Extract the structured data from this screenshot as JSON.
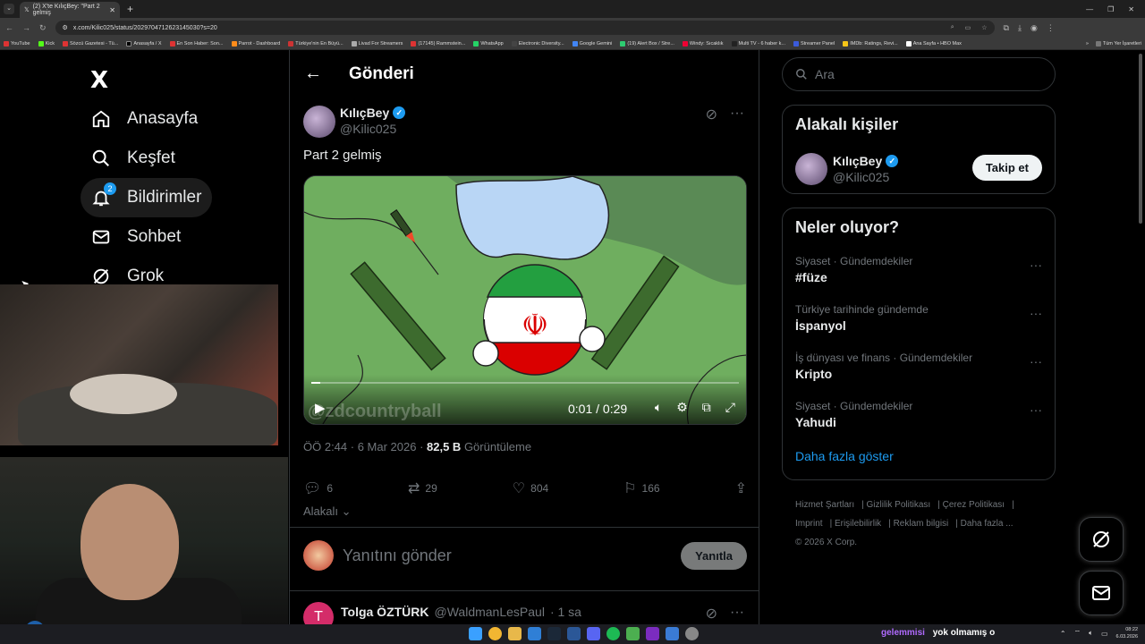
{
  "browser": {
    "tab_title": "(2) X'te KılıçBey: \"Part 2 gelmiş",
    "url": "x.com/Kilic025/status/2029704712623145030?s=20",
    "bookmarks": [
      "YouTube",
      "Kick",
      "Sözcü Gazetesi - Tü...",
      "Anasayfa / X",
      "En Son Haber: Son...",
      "Parrot - Dashboard",
      "Türkiye'nin En Büyü...",
      "Livad For Streamers",
      "(17145) Rammstein...",
      "WhatsApp",
      "Electronic Diversity...",
      "Google Gemini",
      "(19) Alert Box / Stre...",
      "Windy: Sıcaklık",
      "Multi TV - 6 haber k...",
      "Streamer Panel",
      "IMDb: Ratings, Revi...",
      "Ana Sayfa • HBO Max"
    ],
    "all_bookmarks": "Tüm Yer İşaretleri"
  },
  "nav": {
    "logo": "X",
    "items": [
      {
        "label": "Anasayfa"
      },
      {
        "label": "Keşfet"
      },
      {
        "label": "Bildirimler",
        "badge": "2"
      },
      {
        "label": "Sohbet"
      },
      {
        "label": "Grok"
      }
    ]
  },
  "post": {
    "header_title": "Gönderi",
    "author_name": "KılıçBey",
    "author_handle": "@Kilic025",
    "text": "Part 2 gelmiş",
    "video": {
      "time": "0:01 / 0:29",
      "watermark": "@zdcountryball",
      "progress": 0.02
    },
    "meta_time": "ÖÖ 2:44 · 6 Mar 2026 · ",
    "views": "82,5 B",
    "views_label": " Görüntüleme",
    "replies": "6",
    "reposts": "29",
    "likes": "804",
    "bookmarks": "166",
    "related": "Alakalı",
    "reply_placeholder": "Yanıtını gönder",
    "reply_button": "Yanıtla"
  },
  "next_tweet": {
    "avatar_letter": "T",
    "name": "Tolga ÖZTÜRK",
    "handle": "@WaldmanLesPaul",
    "time": "· 1 sa"
  },
  "sidebar": {
    "search_placeholder": "Ara",
    "related_people_title": "Alakalı kişiler",
    "person_name": "KılıçBey",
    "person_handle": "@Kilic025",
    "follow_label": "Takip et",
    "trending_title": "Neler oluyor?",
    "trends": [
      {
        "context": "Siyaset · Gündemdekiler",
        "tag": "#füze"
      },
      {
        "context": "Türkiye tarihinde gündemde",
        "tag": "İspanyol"
      },
      {
        "context": "İş dünyası ve finans · Gündemdekiler",
        "tag": "Kripto"
      },
      {
        "context": "Siyaset · Gündemdekiler",
        "tag": "Yahudi"
      }
    ],
    "show_more": "Daha fazla göster",
    "footer": [
      "Hizmet Şartları",
      "Gizlilik Politikası",
      "Çerez Politikası",
      "Imprint",
      "Erişilebilirlik",
      "Reklam bilgisi",
      "Daha fazla ...",
      "© 2026 X Corp."
    ]
  },
  "taskbar": {
    "chat_user": "gelemmisi",
    "chat_message": "yok olmamış o",
    "time": "08:22",
    "date": "6.03.2026"
  },
  "colors": {
    "accent": "#1d9bf0",
    "background": "#000000",
    "border": "#2f3336",
    "muted": "#71767b"
  }
}
